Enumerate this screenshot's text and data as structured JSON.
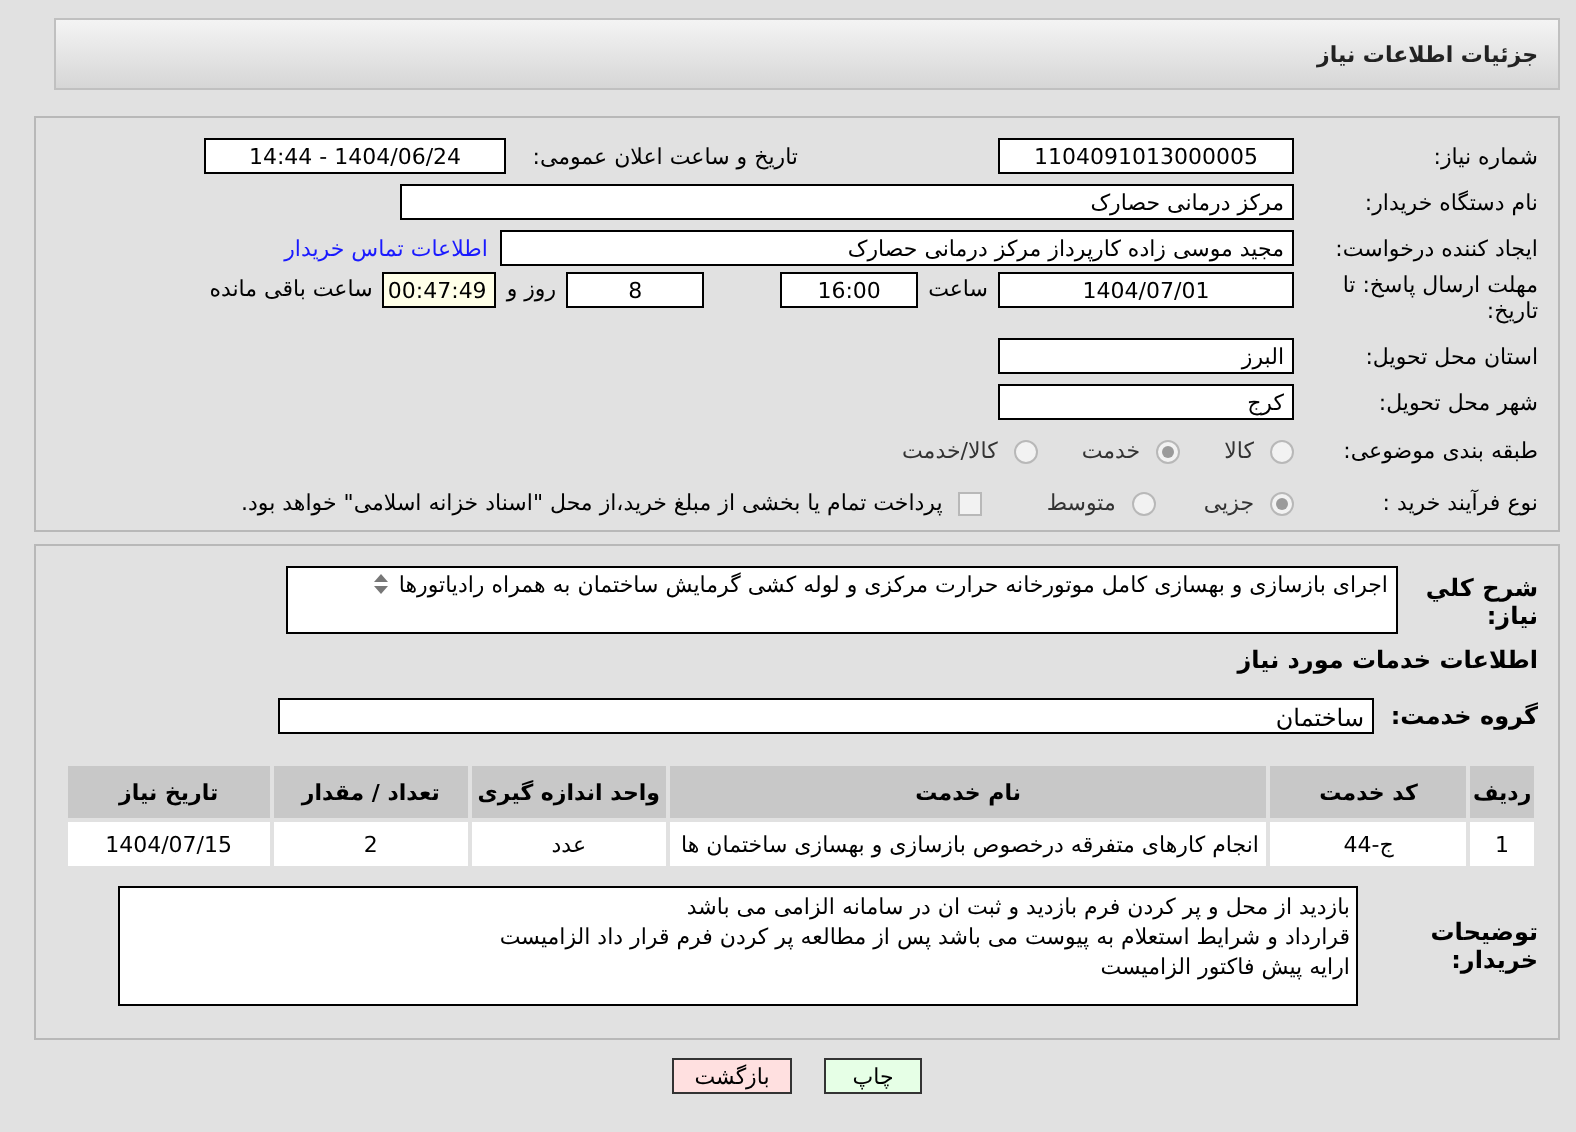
{
  "title": "جزئیات اطلاعات نیاز",
  "need_number": {
    "label": "شماره نیاز:",
    "value": "1104091013000005"
  },
  "announce": {
    "label": "تاریخ و ساعت اعلان عمومی:",
    "value": "1404/06/24 - 14:44"
  },
  "buyer_org": {
    "label": "نام دستگاه خریدار:",
    "value": "مرکز درمانی حصارک"
  },
  "requester": {
    "label": "ایجاد کننده درخواست:",
    "value": "مجید  موسی زاده کارپرداز مرکز درمانی حصارک",
    "link": "اطلاعات تماس خریدار"
  },
  "deadline": {
    "label": "مهلت ارسال پاسخ: تا تاریخ:",
    "date": "1404/07/01",
    "time_label": "ساعت",
    "time": "16:00",
    "days": "8",
    "days_label": "روز و",
    "remaining": "00:47:49",
    "remaining_label": "ساعت باقی مانده"
  },
  "province": {
    "label": "استان محل تحویل:",
    "value": "البرز"
  },
  "city": {
    "label": "شهر محل تحویل:",
    "value": "کرج"
  },
  "category": {
    "label": "طبقه بندی موضوعی:",
    "options": [
      {
        "label": "کالا",
        "selected": false
      },
      {
        "label": "خدمت",
        "selected": true
      },
      {
        "label": "کالا/خدمت",
        "selected": false
      }
    ]
  },
  "process": {
    "label": "نوع فرآیند خرید :",
    "options": [
      {
        "label": "جزیی",
        "selected": true
      },
      {
        "label": "متوسط",
        "selected": false
      }
    ],
    "payment": {
      "label": "پرداخت تمام یا بخشی از مبلغ خرید،از محل \"اسناد خزانه اسلامی\" خواهد بود.",
      "checked": false
    }
  },
  "description": {
    "label": "شرح کلي نياز:",
    "value": "اجرای بازسازی و بهسازی کامل موتورخانه حرارت مرکزی و لوله کشی گرمایش ساختمان به همراه رادیاتورها"
  },
  "services_heading": "اطلاعات خدمات مورد نياز",
  "service_group": {
    "label": "گروه خدمت:",
    "value": "ساختمان"
  },
  "table": {
    "columns": [
      "ردیف",
      "کد خدمت",
      "نام خدمت",
      "واحد اندازه گیری",
      "تعداد / مقدار",
      "تاریخ نیاز"
    ],
    "rows": [
      [
        "1",
        "ج-44",
        "انجام کارهای متفرقه درخصوص بازسازی و بهسازی ساختمان ها",
        "عدد",
        "2",
        "1404/07/15"
      ]
    ]
  },
  "buyer_notes": {
    "label": "توضیحات خریدار:",
    "lines": [
      "بازدید از محل و پر کردن فرم بازدید و ثبت ان در سامانه الزامی می باشد",
      "قرارداد و شرایط استعلام به پیوست می باشد پس از مطالعه پر کردن فرم قرار داد الزامیست",
      "ارایه پیش فاکتور الزامیست"
    ]
  },
  "buttons": [
    {
      "label": "چاپ",
      "kind": "print"
    },
    {
      "label": "بازگشت",
      "kind": "back"
    }
  ]
}
